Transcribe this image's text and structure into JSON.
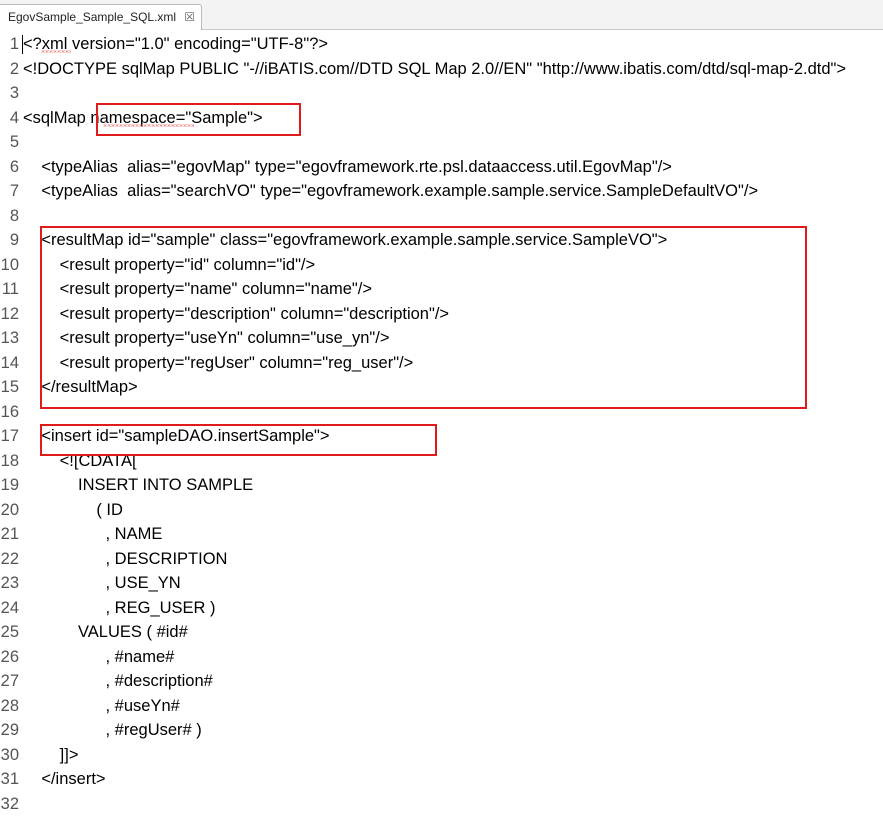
{
  "tab": {
    "title": "EgovSample_Sample_SQL.xml",
    "close_glyph": "☒"
  },
  "lines": [
    {
      "n": "1",
      "text": "<?xml version=\"1.0\" encoding=\"UTF-8\"?>"
    },
    {
      "n": "2",
      "text": "<!DOCTYPE sqlMap PUBLIC \"-//iBATIS.com//DTD SQL Map 2.0//EN\" \"http://www.ibatis.com/dtd/sql-map-2.dtd\">"
    },
    {
      "n": "3",
      "text": ""
    },
    {
      "n": "4",
      "text": "<sqlMap namespace=\"Sample\">"
    },
    {
      "n": "5",
      "text": ""
    },
    {
      "n": "6",
      "text": "    <typeAlias  alias=\"egovMap\" type=\"egovframework.rte.psl.dataaccess.util.EgovMap\"/>"
    },
    {
      "n": "7",
      "text": "    <typeAlias  alias=\"searchVO\" type=\"egovframework.example.sample.service.SampleDefaultVO\"/>"
    },
    {
      "n": "8",
      "text": ""
    },
    {
      "n": "9",
      "text": "    <resultMap id=\"sample\" class=\"egovframework.example.sample.service.SampleVO\">"
    },
    {
      "n": "10",
      "text": "        <result property=\"id\" column=\"id\"/>"
    },
    {
      "n": "11",
      "text": "        <result property=\"name\" column=\"name\"/>"
    },
    {
      "n": "12",
      "text": "        <result property=\"description\" column=\"description\"/>"
    },
    {
      "n": "13",
      "text": "        <result property=\"useYn\" column=\"use_yn\"/>"
    },
    {
      "n": "14",
      "text": "        <result property=\"regUser\" column=\"reg_user\"/>"
    },
    {
      "n": "15",
      "text": "    </resultMap>"
    },
    {
      "n": "16",
      "text": ""
    },
    {
      "n": "17",
      "text": "    <insert id=\"sampleDAO.insertSample\">"
    },
    {
      "n": "18",
      "text": "        <![CDATA["
    },
    {
      "n": "19",
      "text": "            INSERT INTO SAMPLE"
    },
    {
      "n": "20",
      "text": "                ( ID"
    },
    {
      "n": "21",
      "text": "                  , NAME"
    },
    {
      "n": "22",
      "text": "                  , DESCRIPTION"
    },
    {
      "n": "23",
      "text": "                  , USE_YN"
    },
    {
      "n": "24",
      "text": "                  , REG_USER )"
    },
    {
      "n": "25",
      "text": "            VALUES ( #id#"
    },
    {
      "n": "26",
      "text": "                  , #name#"
    },
    {
      "n": "27",
      "text": "                  , #description#"
    },
    {
      "n": "28",
      "text": "                  , #useYn#"
    },
    {
      "n": "29",
      "text": "                  , #regUser# )"
    },
    {
      "n": "30",
      "text": "        ]]>"
    },
    {
      "n": "31",
      "text": "    </insert>"
    },
    {
      "n": "32",
      "text": ""
    }
  ],
  "colors": {
    "highlight_box": "#e01b1b",
    "spell_squiggle": "#e53a3a"
  }
}
